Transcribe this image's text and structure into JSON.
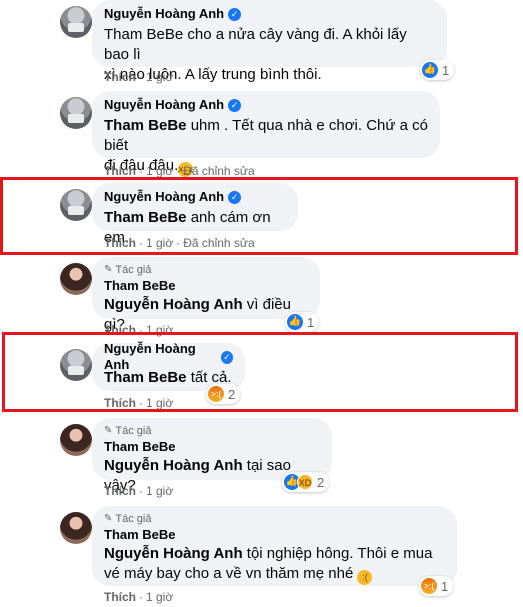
{
  "colors": {
    "highlight": "#e8141c",
    "like_blue": "#1877f2",
    "bubble_bg": "#f0f2f5"
  },
  "comments": [
    {
      "author": "Nguyễn Hoàng Anh",
      "verified": true,
      "text_lines": [
        "Tham BeBe cho a nửa cây vàng đi. A khỏi lấy bao lì",
        "xì nào luôn. A lấy trung bình thôi."
      ],
      "mention": "",
      "like_label": "Thích",
      "time": "1 giờ",
      "edited": "",
      "reaction_count": "1",
      "reaction_icon": "like-icon"
    },
    {
      "author": "Nguyễn Hoàng Anh",
      "verified": true,
      "mention": "Tham BeBe",
      "text_line1": " uhm . Tết qua nhà e chơi. Chứ a có biết",
      "text_line2": "đi đâu đâu.",
      "emoji": "tired-face-emoji",
      "like_label": "Thích",
      "time": "1 giờ",
      "edited": "Đã chỉnh sửa"
    },
    {
      "author": "Nguyễn Hoàng Anh",
      "verified": true,
      "mention": "Tham BeBe",
      "text": " anh cám ơn em.",
      "like_label": "Thích",
      "time": "1 giờ",
      "edited": "Đã chỉnh sửa"
    },
    {
      "author_badge": "Tác giả",
      "author": "Tham BeBe",
      "mention": "Nguyễn Hoàng Anh",
      "text": " vì điều gì?",
      "like_label": "Thích",
      "time": "1 giờ",
      "reaction_count": "1",
      "reaction_icon": "like-icon"
    },
    {
      "author": "Nguyễn Hoàng Anh",
      "verified": true,
      "mention": "Tham BeBe",
      "text": " tất cả.",
      "like_label": "Thích",
      "time": "1 giờ",
      "reaction_count": "2",
      "reaction_icon": "angry-icon"
    },
    {
      "author_badge": "Tác giả",
      "author": "Tham BeBe",
      "mention": "Nguyễn Hoàng Anh",
      "text": " tại sao vậy?",
      "like_label": "Thích",
      "time": "1 giờ",
      "reaction_count": "2",
      "reaction_icon": "like-haha-icons"
    },
    {
      "author_badge": "Tác giả",
      "author": "Tham BeBe",
      "mention": "Nguyễn Hoàng Anh",
      "text_line1": " tội nghiệp hông. Thôi e mua",
      "text_line2": "vé máy bay cho a về vn thăm mẹ nhé",
      "emoji": "disappointed-face-emoji",
      "like_label": "Thích",
      "time": "1 giờ",
      "reaction_count": "1",
      "reaction_icon": "angry-icon"
    }
  ]
}
